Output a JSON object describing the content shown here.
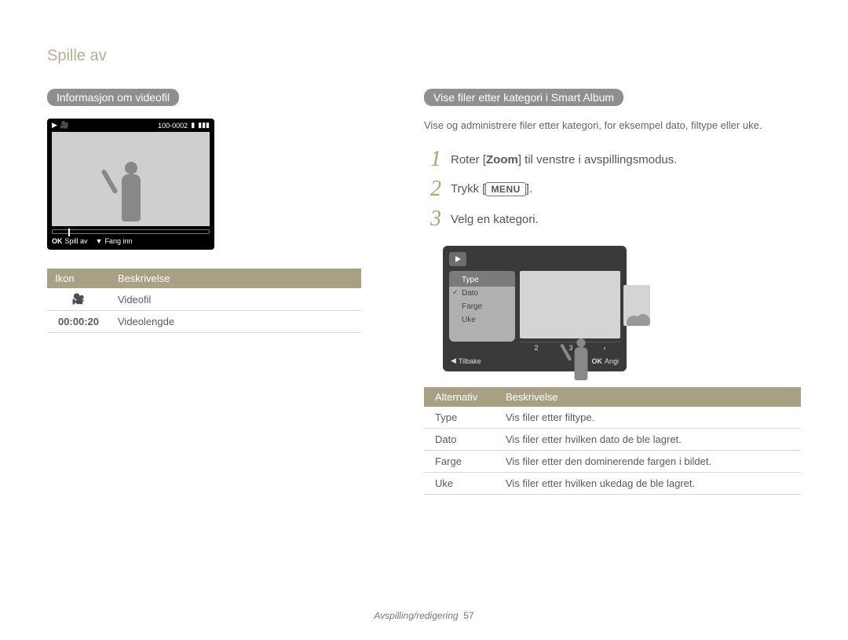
{
  "breadcrumb": "Spille av",
  "left": {
    "heading": "Informasjon om videofil",
    "display": {
      "counter": "100-0002",
      "ok_label": "Spill av",
      "down_label": "Fang inn"
    },
    "table": {
      "col_icon": "Ikon",
      "col_desc": "Beskrivelse",
      "rows": [
        {
          "icon_name": "camera-icon",
          "icon_text": "",
          "desc": "Videofil"
        },
        {
          "icon_name": "timecode",
          "icon_text": "00:00:20",
          "desc": "Videolengde"
        }
      ]
    }
  },
  "right": {
    "heading": "Vise filer etter kategori i Smart Album",
    "intro": "Vise og administrere filer etter kategori, for eksempel dato, filtype eller uke.",
    "steps": [
      {
        "n": "1",
        "pre": "Roter [",
        "bold": "Zoom",
        "post": "] til venstre i avspillingsmodus."
      },
      {
        "n": "2",
        "pre": "Trykk [",
        "menu": "MENU",
        "post": "]."
      },
      {
        "n": "3",
        "pre": "Velg en kategori.",
        "bold": "",
        "post": ""
      }
    ],
    "sa_menu": {
      "header": "Type",
      "items": [
        "Dato",
        "Farge",
        "Uke"
      ],
      "checked": "Dato",
      "scale": [
        "2",
        "3",
        "›"
      ],
      "back_label": "Tilbake",
      "ok_label": "Angi"
    },
    "alt_table": {
      "col_opt": "Alternativ",
      "col_desc": "Beskrivelse",
      "rows": [
        {
          "opt": "Type",
          "desc": "Vis filer etter filtype."
        },
        {
          "opt": "Dato",
          "desc": "Vis filer etter hvilken dato de ble lagret."
        },
        {
          "opt": "Farge",
          "desc": "Vis filer etter den dominerende fargen i bildet."
        },
        {
          "opt": "Uke",
          "desc": "Vis filer etter hvilken ukedag de ble lagret."
        }
      ]
    }
  },
  "footer": {
    "section": "Avspilling/redigering",
    "page": "57"
  }
}
